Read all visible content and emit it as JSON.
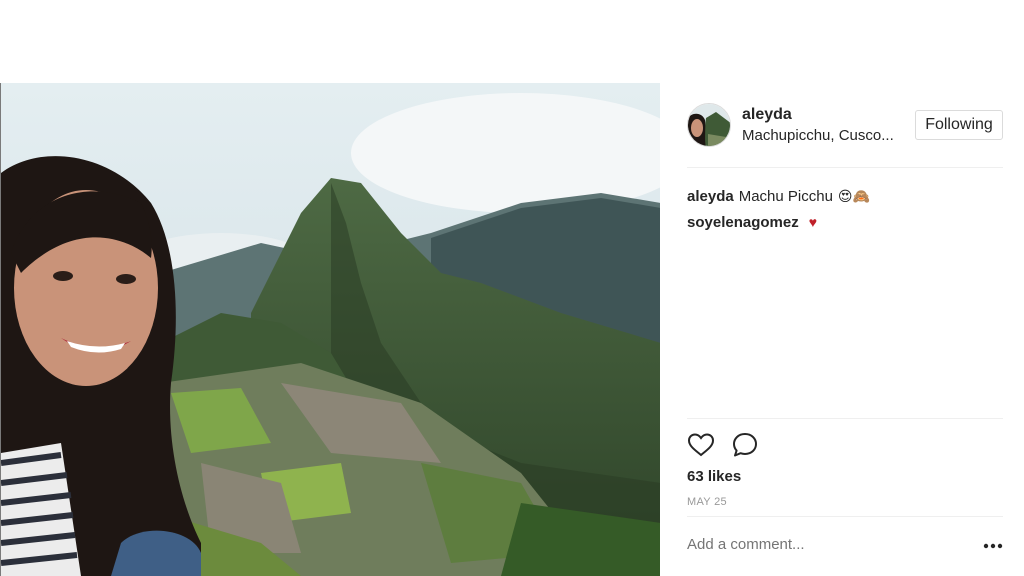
{
  "post": {
    "username": "aleyda",
    "location": "Machupicchu, Cusco...",
    "follow_label": "Following",
    "caption": {
      "user": "aleyda",
      "text": "Machu Picchu",
      "emojis": "😍🙈"
    },
    "comments": [
      {
        "user": "soyelenagomez",
        "text": "",
        "heart": "♥"
      }
    ],
    "likes": "63 likes",
    "date": "MAY 25",
    "comment_placeholder": "Add a comment...",
    "more_label": "•••"
  },
  "icons": {
    "like": "heart-outline-icon",
    "comment": "speech-bubble-icon",
    "more": "ellipsis-icon"
  },
  "colors": {
    "text": "#262626",
    "muted": "#999999",
    "divider": "#efefef",
    "heart": "#c0202a"
  }
}
